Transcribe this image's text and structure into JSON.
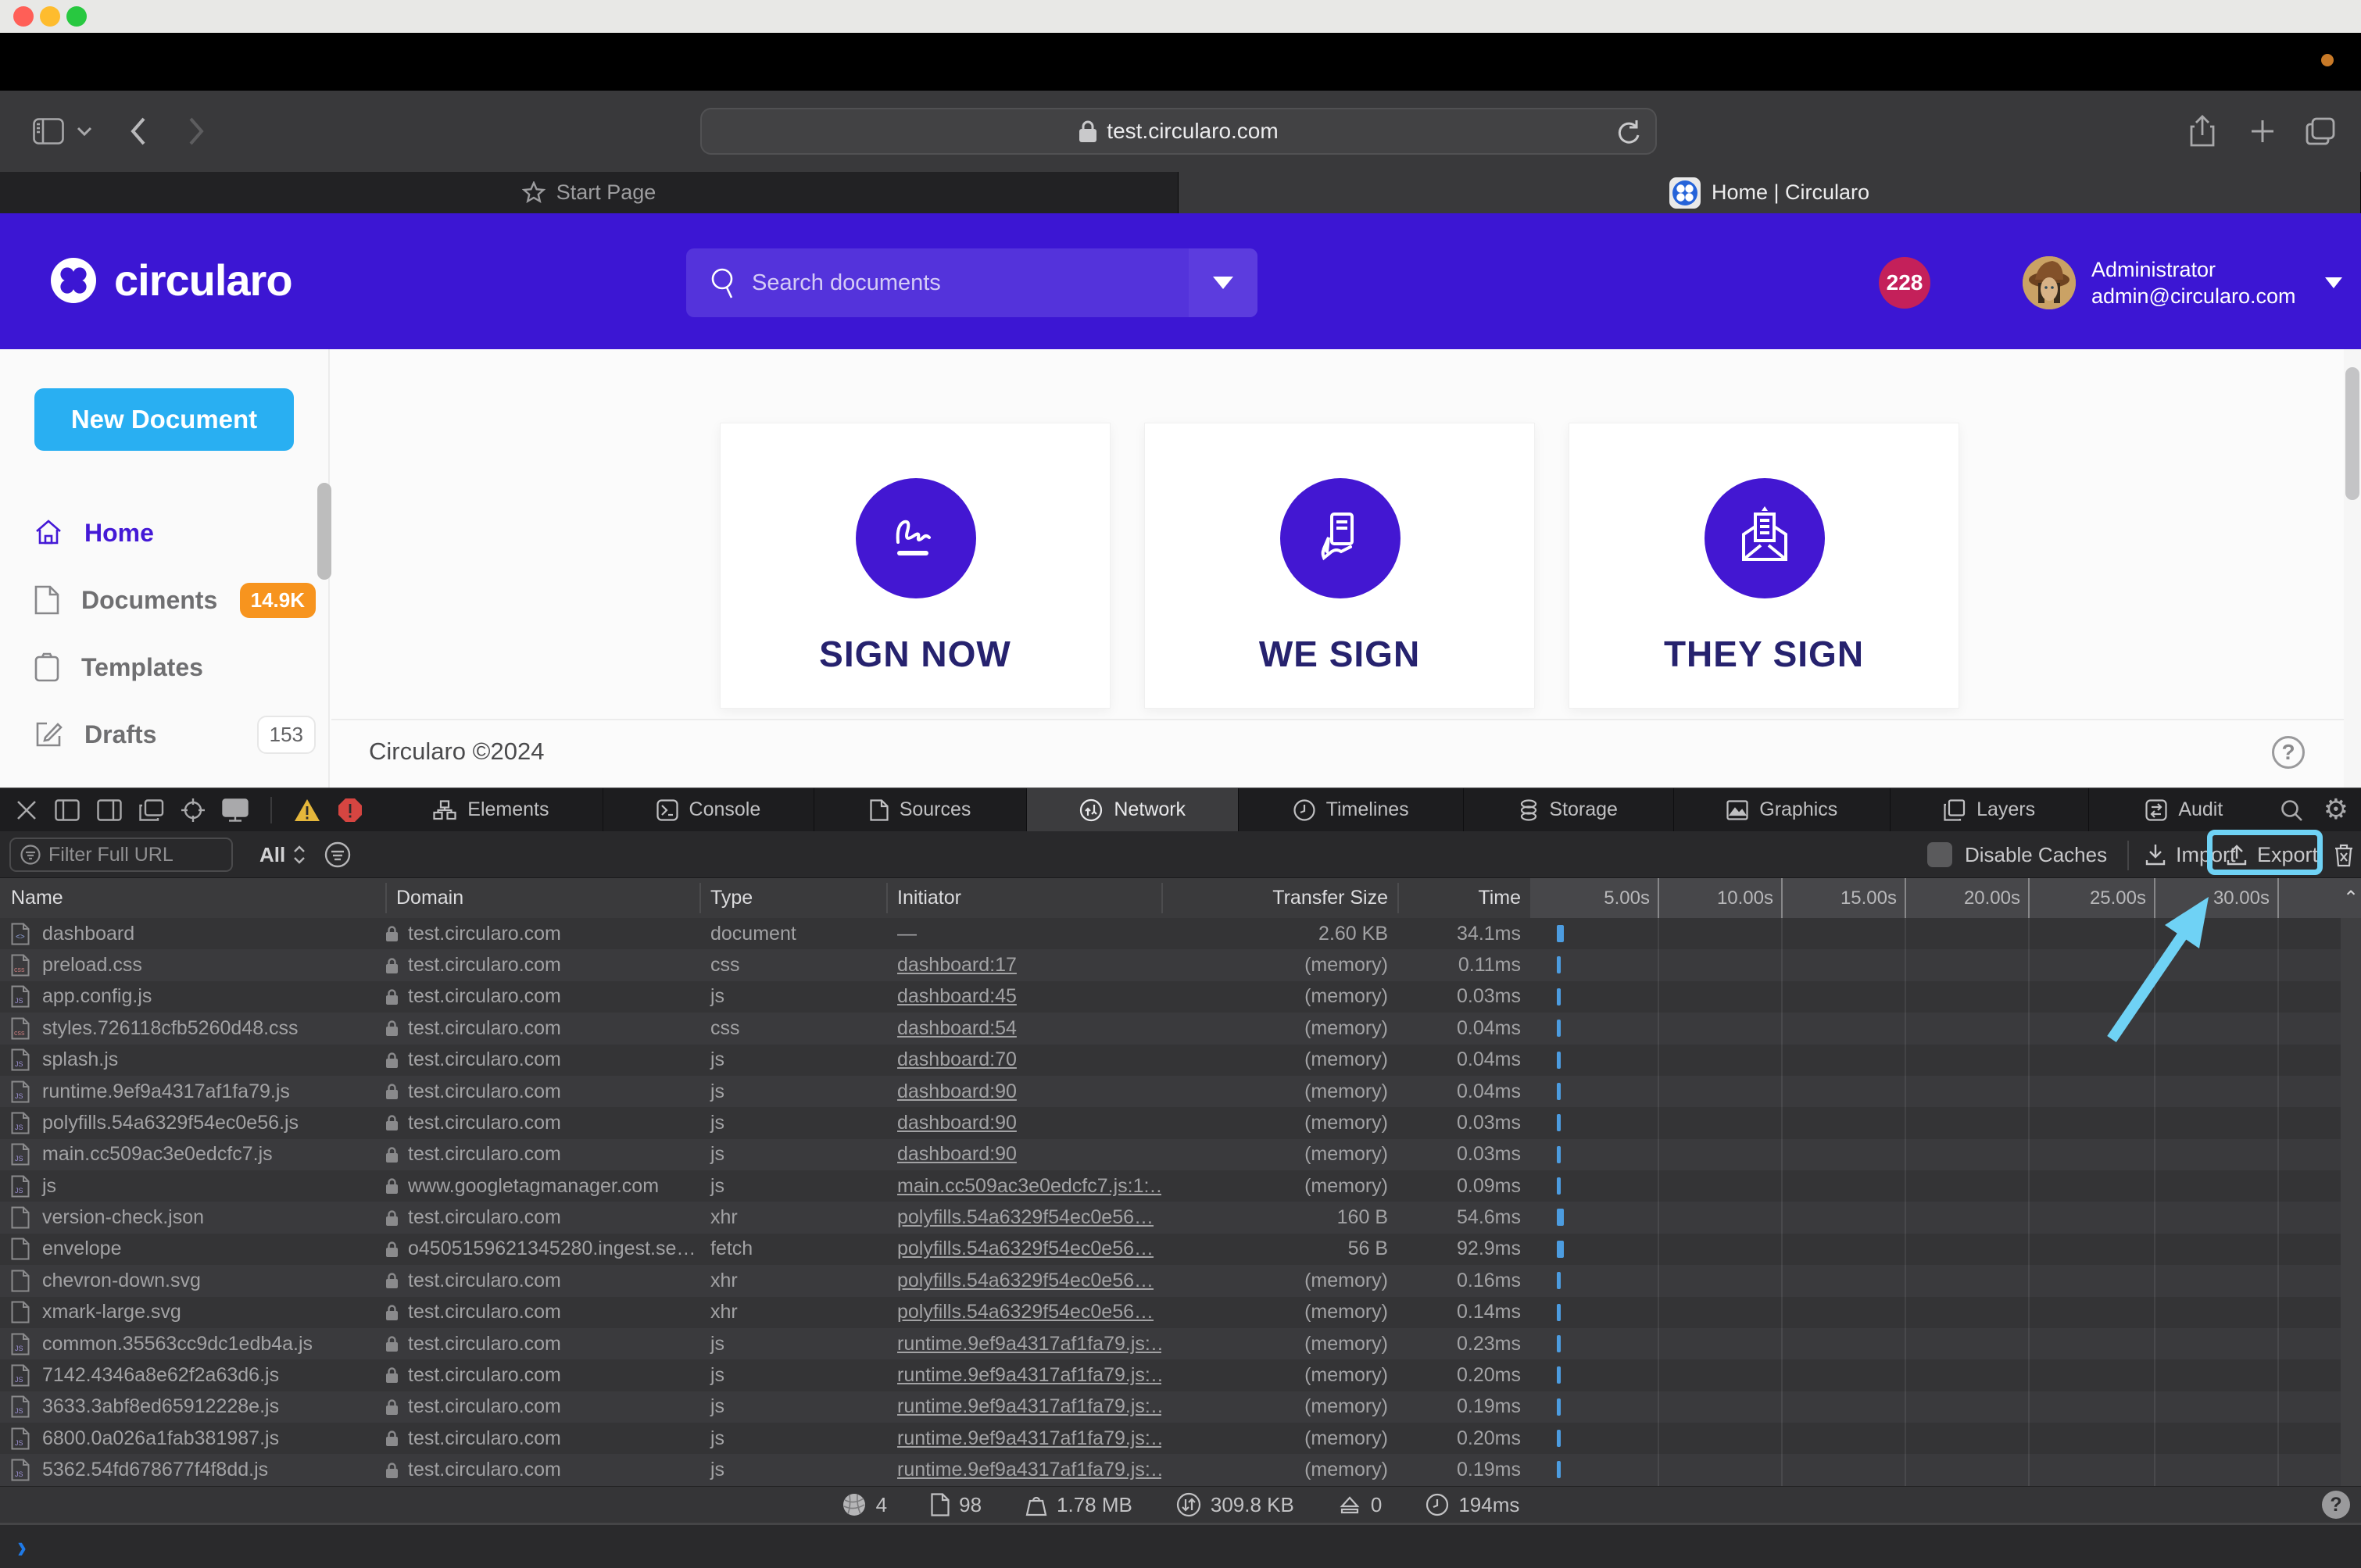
{
  "browser": {
    "url": "test.circularo.com",
    "tabs": [
      {
        "label": "Start Page"
      },
      {
        "label": "Home | Circularo"
      }
    ]
  },
  "header": {
    "brand": "circularo",
    "search_placeholder": "Search documents",
    "notification_count": "228",
    "user_name": "Administrator",
    "user_email": "admin@circularo.com"
  },
  "sidebar": {
    "new_document_label": "New Document",
    "items": [
      {
        "label": "Home"
      },
      {
        "label": "Documents",
        "badge": "14.9K"
      },
      {
        "label": "Templates"
      },
      {
        "label": "Drafts",
        "badge": "153"
      }
    ]
  },
  "main": {
    "cards": [
      {
        "title": "SIGN NOW"
      },
      {
        "title": "WE SIGN"
      },
      {
        "title": "THEY SIGN"
      }
    ],
    "footer_text": "Circularo ©2024"
  },
  "devtools": {
    "tabs": [
      "Elements",
      "Console",
      "Sources",
      "Network",
      "Timelines",
      "Storage",
      "Graphics",
      "Layers",
      "Audit"
    ],
    "active_tab": "Network",
    "filter_placeholder": "Filter Full URL",
    "scope_label": "All",
    "disable_caches_label": "Disable Caches",
    "import_label": "Import",
    "export_label": "Export",
    "columns": {
      "name": "Name",
      "domain": "Domain",
      "type": "Type",
      "initiator": "Initiator",
      "transfer": "Transfer Size",
      "time": "Time"
    },
    "timeline_ticks": [
      "5.00s",
      "10.00s",
      "15.00s",
      "20.00s",
      "25.00s",
      "30.00s"
    ],
    "accent_colors": {
      "waterfall_blue": "#4c9ce0",
      "highlight_cyan": "#6fd2f5",
      "warning_yellow": "#e5b73b",
      "error_red": "#d64541"
    },
    "rows": [
      {
        "name": "dashboard",
        "icon": "doc",
        "domain": "test.circularo.com",
        "type": "document",
        "initiator": "—",
        "link": false,
        "size": "2.60 KB",
        "time": "34.1ms",
        "wide": true
      },
      {
        "name": "preload.css",
        "icon": "css",
        "domain": "test.circularo.com",
        "type": "css",
        "initiator": "dashboard:17",
        "link": true,
        "size": "(memory)",
        "time": "0.11ms",
        "wide": false
      },
      {
        "name": "app.config.js",
        "icon": "js",
        "domain": "test.circularo.com",
        "type": "js",
        "initiator": "dashboard:45",
        "link": true,
        "size": "(memory)",
        "time": "0.03ms",
        "wide": false
      },
      {
        "name": "styles.726118cfb5260d48.css",
        "icon": "css",
        "domain": "test.circularo.com",
        "type": "css",
        "initiator": "dashboard:54",
        "link": true,
        "size": "(memory)",
        "time": "0.04ms",
        "wide": false
      },
      {
        "name": "splash.js",
        "icon": "js",
        "domain": "test.circularo.com",
        "type": "js",
        "initiator": "dashboard:70",
        "link": true,
        "size": "(memory)",
        "time": "0.04ms",
        "wide": false
      },
      {
        "name": "runtime.9ef9a4317af1fa79.js",
        "icon": "js",
        "domain": "test.circularo.com",
        "type": "js",
        "initiator": "dashboard:90",
        "link": true,
        "size": "(memory)",
        "time": "0.04ms",
        "wide": false
      },
      {
        "name": "polyfills.54a6329f54ec0e56.js",
        "icon": "js",
        "domain": "test.circularo.com",
        "type": "js",
        "initiator": "dashboard:90",
        "link": true,
        "size": "(memory)",
        "time": "0.03ms",
        "wide": false
      },
      {
        "name": "main.cc509ac3e0edcfc7.js",
        "icon": "js",
        "domain": "test.circularo.com",
        "type": "js",
        "initiator": "dashboard:90",
        "link": true,
        "size": "(memory)",
        "time": "0.03ms",
        "wide": false
      },
      {
        "name": "js",
        "icon": "js",
        "domain": "www.googletagmanager.com",
        "type": "js",
        "initiator": "main.cc509ac3e0edcfc7.js:1:…",
        "link": true,
        "size": "(memory)",
        "time": "0.09ms",
        "wide": false
      },
      {
        "name": "version-check.json",
        "icon": "plain",
        "domain": "test.circularo.com",
        "type": "xhr",
        "initiator": "polyfills.54a6329f54ec0e56…",
        "link": true,
        "size": "160 B",
        "time": "54.6ms",
        "wide": true
      },
      {
        "name": "envelope",
        "icon": "plain",
        "domain": "o4505159621345280.ingest.se…",
        "type": "fetch",
        "initiator": "polyfills.54a6329f54ec0e56…",
        "link": true,
        "size": "56 B",
        "time": "92.9ms",
        "wide": true
      },
      {
        "name": "chevron-down.svg",
        "icon": "plain",
        "domain": "test.circularo.com",
        "type": "xhr",
        "initiator": "polyfills.54a6329f54ec0e56…",
        "link": true,
        "size": "(memory)",
        "time": "0.16ms",
        "wide": false
      },
      {
        "name": "xmark-large.svg",
        "icon": "plain",
        "domain": "test.circularo.com",
        "type": "xhr",
        "initiator": "polyfills.54a6329f54ec0e56…",
        "link": true,
        "size": "(memory)",
        "time": "0.14ms",
        "wide": false
      },
      {
        "name": "common.35563cc9dc1edb4a.js",
        "icon": "js",
        "domain": "test.circularo.com",
        "type": "js",
        "initiator": "runtime.9ef9a4317af1fa79.js:…",
        "link": true,
        "size": "(memory)",
        "time": "0.23ms",
        "wide": false
      },
      {
        "name": "7142.4346a8e62f2a63d6.js",
        "icon": "js",
        "domain": "test.circularo.com",
        "type": "js",
        "initiator": "runtime.9ef9a4317af1fa79.js:…",
        "link": true,
        "size": "(memory)",
        "time": "0.20ms",
        "wide": false
      },
      {
        "name": "3633.3abf8ed65912228e.js",
        "icon": "js",
        "domain": "test.circularo.com",
        "type": "js",
        "initiator": "runtime.9ef9a4317af1fa79.js:…",
        "link": true,
        "size": "(memory)",
        "time": "0.19ms",
        "wide": false
      },
      {
        "name": "6800.0a026a1fab381987.js",
        "icon": "js",
        "domain": "test.circularo.com",
        "type": "js",
        "initiator": "runtime.9ef9a4317af1fa79.js:…",
        "link": true,
        "size": "(memory)",
        "time": "0.20ms",
        "wide": false
      },
      {
        "name": "5362.54fd678677f4f8dd.js",
        "icon": "js",
        "domain": "test.circularo.com",
        "type": "js",
        "initiator": "runtime.9ef9a4317af1fa79.js:…",
        "link": true,
        "size": "(memory)",
        "time": "0.19ms",
        "wide": false
      }
    ],
    "status": {
      "domains": "4",
      "resources": "98",
      "size": "1.78 MB",
      "transferred": "309.8 KB",
      "queued": "0",
      "load_time": "194ms"
    }
  }
}
